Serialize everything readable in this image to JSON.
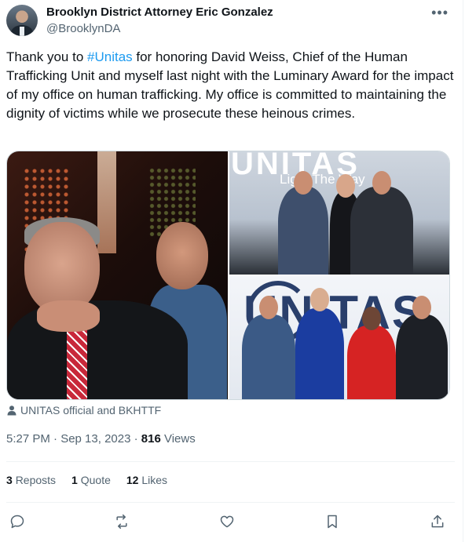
{
  "tweet": {
    "author_name": "Brooklyn District Attorney Eric Gonzalez",
    "author_handle": "@BrooklynDA",
    "more_icon": "more-horizontal-icon",
    "text_before": "Thank you to ",
    "hashtag": "#Unitas",
    "text_after": " for honoring David Weiss, Chief of the Human Trafficking Unit and myself last night with the Luminary Award for the impact of my office on human trafficking. My office is committed to maintaining the dignity of victims while we prosecute these heinous crimes.",
    "photo2_sign": "UNITAS",
    "photo2_tagline": "Light The Way",
    "photo3_sign": "UNITAS",
    "tagged_users": "UNITAS official and BKHTTF",
    "timestamp": "5:27 PM · Sep 13, 2023",
    "separator": " · ",
    "views_count": "816",
    "views_label": "Views",
    "reposts_count": "3",
    "reposts_label": "Reposts",
    "quotes_count": "1",
    "quotes_label": "Quote",
    "likes_count": "12",
    "likes_label": "Likes"
  },
  "colors": {
    "link": "#1d9bf0",
    "secondary_text": "#536471",
    "primary_text": "#0f1419",
    "divider": "#eff3f4"
  },
  "actions": [
    "reply-icon",
    "repost-icon",
    "like-icon",
    "bookmark-icon",
    "share-icon"
  ]
}
